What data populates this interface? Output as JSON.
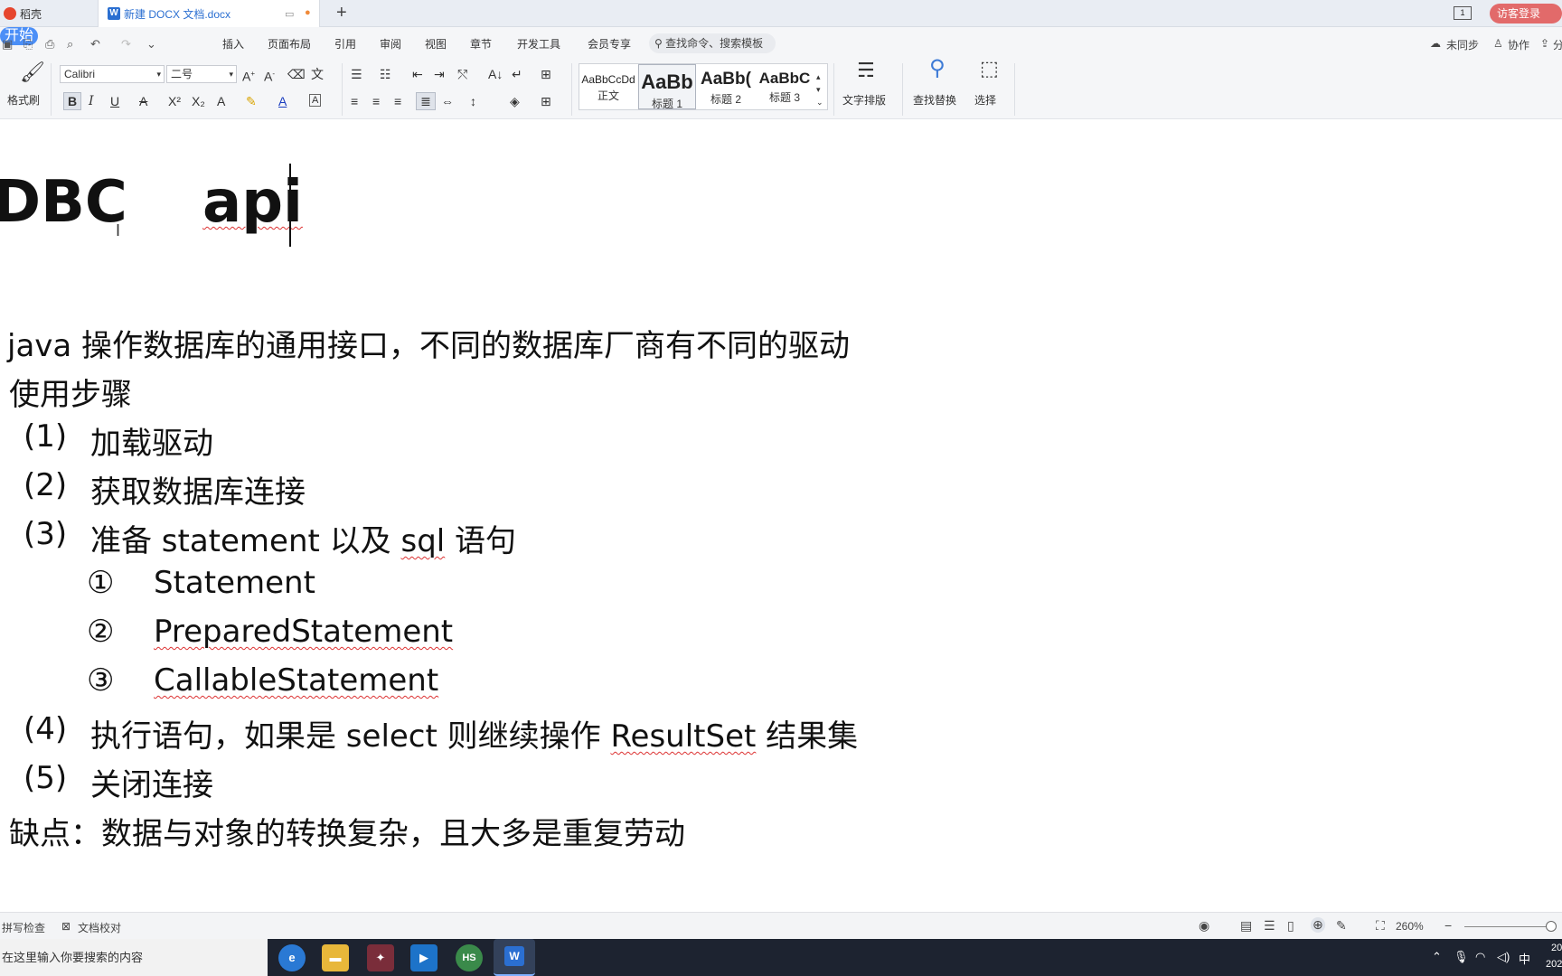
{
  "tabs": {
    "wps_home": "稻壳",
    "document": "新建 DOCX 文档.docx",
    "new_tab": "+"
  },
  "titlebar": {
    "window_count": "1",
    "login": "访客登录"
  },
  "menu": {
    "items": [
      "开始",
      "插入",
      "页面布局",
      "引用",
      "审阅",
      "视图",
      "章节",
      "开发工具",
      "会员专享"
    ],
    "search_placeholder": "查找命令、搜索模板",
    "sync": "未同步",
    "collab": "协作",
    "share_glyph": "分"
  },
  "ribbon": {
    "format_painter": "格式刷",
    "font_name": "Calibri",
    "font_size": "二号",
    "styles": [
      {
        "preview": "AaBbCcDd",
        "label": "正文"
      },
      {
        "preview": "AaBb",
        "label": "标题 1"
      },
      {
        "preview": "AaBb(",
        "label": "标题 2"
      },
      {
        "preview": "AaBbC",
        "label": "标题 3"
      }
    ],
    "text_layout": "文字排版",
    "find_replace": "查找替换",
    "select": "选择"
  },
  "document": {
    "title_left": "DBC",
    "title_right": "api",
    "para1": "java 操作数据库的通用接口，不同的数据库厂商有不同的驱动",
    "para2": "使用步骤",
    "steps": [
      {
        "num": "(1)",
        "text": "加载驱动"
      },
      {
        "num": "(2)",
        "text": "获取数据库连接"
      },
      {
        "num": "(3)",
        "text_a": "准备 statement 以及 ",
        "text_b": "sql",
        "text_c": " 语句"
      },
      {
        "num": "(4)",
        "text_a": "执行语句，如果是 select 则继续操作 ",
        "text_b": "ResultSet",
        "text_c": " 结果集"
      },
      {
        "num": "(5)",
        "text": "关闭连接"
      }
    ],
    "substeps": [
      {
        "num": "①",
        "text": "Statement"
      },
      {
        "num": "②",
        "text": "PreparedStatement"
      },
      {
        "num": "③",
        "text": "CallableStatement"
      }
    ],
    "para_last": "缺点：数据与对象的转换复杂，且大多是重复劳动"
  },
  "statusbar": {
    "spell_check": "拼写检查",
    "doc_proof": "文档校对",
    "zoom": "260%"
  },
  "taskbar": {
    "search_placeholder": "在这里输入你要搜索的内容",
    "ime": "中",
    "clock_line1": "20",
    "clock_line2": "202"
  },
  "icons": [
    "document-icon",
    "wps-logo-icon",
    "search-icon",
    "cloud-icon",
    "user-icon",
    "share-icon",
    "bold-icon",
    "italic-icon",
    "underline-icon",
    "eye-icon",
    "edge-icon",
    "folder-icon",
    "mic-icon",
    "wifi-icon",
    "volume-icon"
  ],
  "colors": {
    "accent": "#4b8ff7",
    "login": "#e26a6a",
    "spell_underline": "#dd3333"
  }
}
